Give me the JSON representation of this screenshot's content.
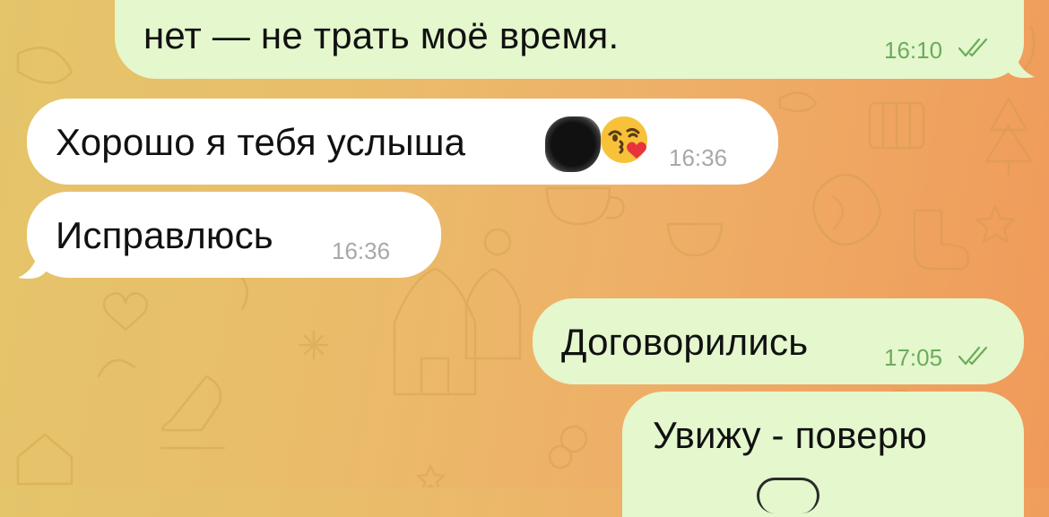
{
  "chat": {
    "messages": [
      {
        "direction": "out",
        "text": "нет — не трать моё время.",
        "time": "16:10",
        "status": "read"
      },
      {
        "direction": "in",
        "text": "Хорошо я тебя услыша",
        "time": "16:36",
        "emoji": "kissing-face-with-heart-emoji"
      },
      {
        "direction": "in",
        "text": "Исправлюсь",
        "time": "16:36"
      },
      {
        "direction": "out",
        "text": "Договорились",
        "time": "17:05",
        "status": "read"
      },
      {
        "direction": "out",
        "text": "Увижу - поверю"
      }
    ]
  },
  "colors": {
    "outgoing_bubble": "#e4f7cd",
    "incoming_bubble": "#ffffff",
    "outgoing_time": "#6dab5b",
    "incoming_time": "#a8a8a8",
    "background_start": "#e4c56a",
    "background_end": "#f09a5a"
  }
}
